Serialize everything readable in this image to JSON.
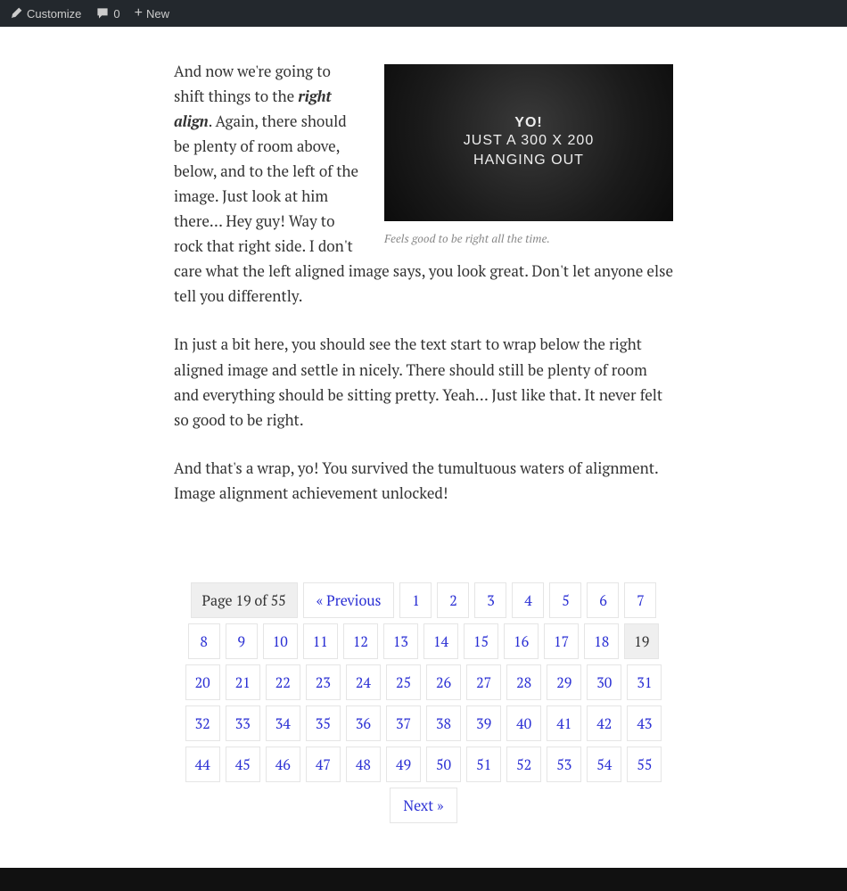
{
  "adminbar": {
    "customize": "Customize",
    "comments_count": "0",
    "new": "New"
  },
  "content": {
    "para_top_prefix": "And now we're going to shift things to the ",
    "para_top_em": "right align",
    "para_top_suffix": ". Again, there should be plenty of room above, below, and to the left of the image. Just look at him there… Hey guy! Way to rock that right side. I don't care what the left aligned image says, you look great. Don't let anyone else tell you differently.",
    "para_mid": "In just a bit here, you should see the text start to wrap below the right aligned image and settle in nicely. There should still be plenty of room and everything should be sitting pretty. Yeah… Just like that. It never felt so good to be right.",
    "para_end": "And that's a wrap, yo! You survived the tumultuous waters of alignment. Image alignment achievement unlocked!"
  },
  "figure": {
    "line1": "YO!",
    "line2": "JUST A 300 X 200",
    "line3": "HANGING OUT",
    "caption": "Feels good to be right all the time."
  },
  "pagination": {
    "info": "Page 19 of 55",
    "prev": "« Previous",
    "next": "Next »",
    "current": 19,
    "pages": [
      1,
      2,
      3,
      4,
      5,
      6,
      7,
      8,
      9,
      10,
      11,
      12,
      13,
      14,
      15,
      16,
      17,
      18,
      19,
      20,
      21,
      22,
      23,
      24,
      25,
      26,
      27,
      28,
      29,
      30,
      31,
      32,
      33,
      34,
      35,
      36,
      37,
      38,
      39,
      40,
      41,
      42,
      43,
      44,
      45,
      46,
      47,
      48,
      49,
      50,
      51,
      52,
      53,
      54,
      55
    ]
  }
}
